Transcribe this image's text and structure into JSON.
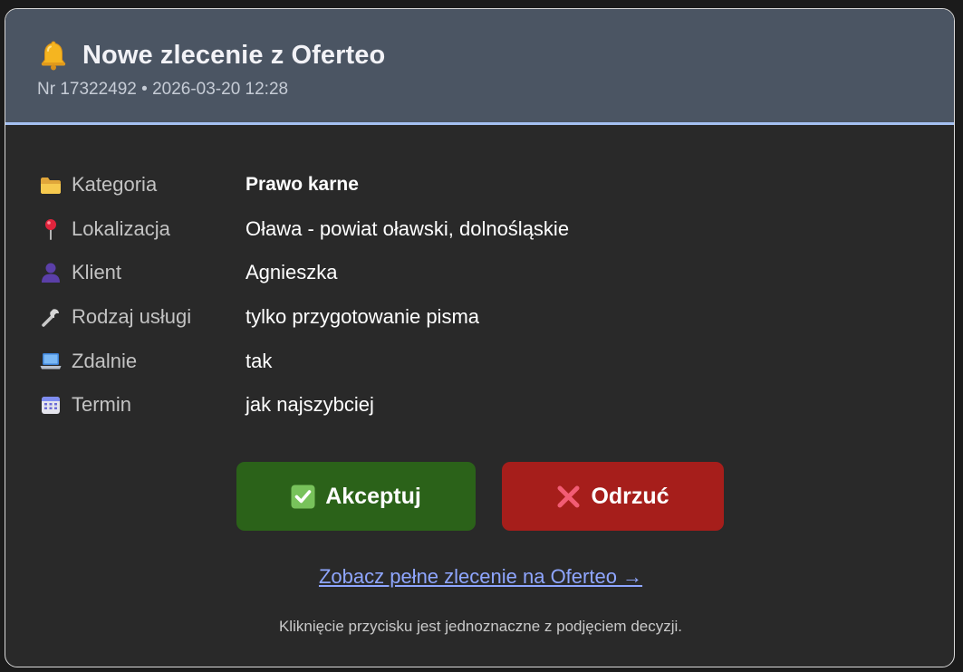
{
  "header": {
    "title": "Nowe zlecenie z Oferteo",
    "subtitle": "Nr 17322492 • 2026-03-20 12:28",
    "icon": "bell-icon"
  },
  "details": [
    {
      "icon": "folder-icon",
      "label": "Kategoria",
      "value": "Prawo karne"
    },
    {
      "icon": "pin-icon",
      "label": "Lokalizacja",
      "value": "Oława - powiat oławski, dolnośląskie"
    },
    {
      "icon": "person-icon",
      "label": "Klient",
      "value": "Agnieszka"
    },
    {
      "icon": "wrench-icon",
      "label": "Rodzaj usługi",
      "value": "tylko przygotowanie pisma"
    },
    {
      "icon": "laptop-icon",
      "label": "Zdalnie",
      "value": "tak"
    },
    {
      "icon": "calendar-icon",
      "label": "Termin",
      "value": "jak najszybciej"
    }
  ],
  "actions": {
    "accept_label": "Akceptuj",
    "reject_label": "Odrzuć"
  },
  "link_text": "Zobacz pełne zlecenie na Oferteo →",
  "note": "Kliknięcie przycisku jest jednoznaczne z podjęciem decyzji.",
  "colors": {
    "header_bg": "#4b5563",
    "header_border": "#a5c1f2",
    "card_bg": "#292929",
    "accept": "#2b6219",
    "reject": "#a61e1b",
    "link": "#8fa6ff"
  }
}
